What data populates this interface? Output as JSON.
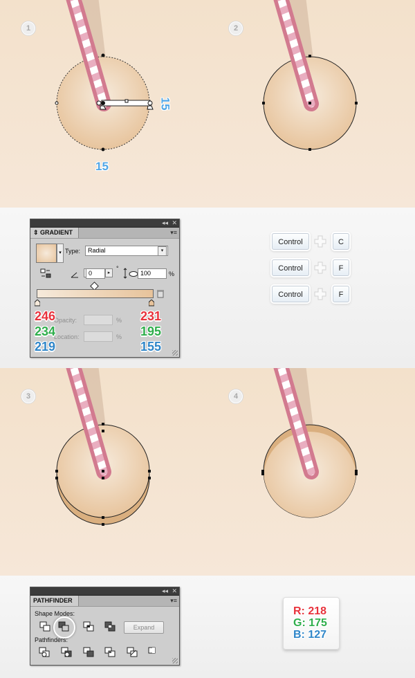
{
  "steps": {
    "s1": "1",
    "s2": "2",
    "s3": "3",
    "s4": "4"
  },
  "dimensions": {
    "width_label": "15",
    "height_label": "15"
  },
  "gradient_panel": {
    "collapse_glyph": "◂◂",
    "close_glyph": "✕",
    "tab_title": "GRADIENT",
    "menu_glyph": "▾≡",
    "type_label": "Type:",
    "type_value": "Radial",
    "angle_value": "0",
    "degree_symbol": "°",
    "aspect_value": "100",
    "percent_symbol": "%",
    "opacity_label": "Opacity:",
    "location_label": "Location:",
    "left_stop": {
      "r": "246",
      "g": "234",
      "b": "219"
    },
    "right_stop": {
      "r": "231",
      "g": "195",
      "b": "155"
    },
    "gradient_start_color": "#F6EADB",
    "gradient_end_color": "#E7C39B"
  },
  "shortcuts": [
    {
      "mod": "Control",
      "key": "C"
    },
    {
      "mod": "Control",
      "key": "F"
    },
    {
      "mod": "Control",
      "key": "F"
    }
  ],
  "pathfinder_panel": {
    "collapse_glyph": "◂◂",
    "close_glyph": "✕",
    "tab_title": "PATHFINDER",
    "menu_glyph": "▾≡",
    "shape_modes_label": "Shape Modes:",
    "expand_label": "Expand",
    "pathfinders_label": "Pathfinders:"
  },
  "rgb_box": {
    "r": "R: 218",
    "g": "G: 175",
    "b": "B: 127"
  },
  "colors": {
    "red": "#e8323c",
    "green": "#2fae4c",
    "blue": "#2f86c9",
    "dim_blue": "#50a6e6"
  }
}
